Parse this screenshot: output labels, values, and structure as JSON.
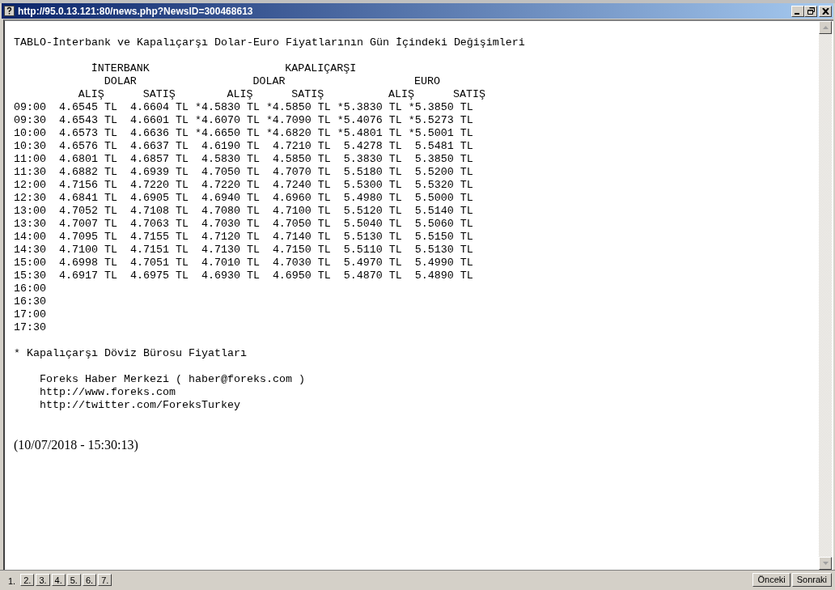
{
  "window": {
    "title": "http://95.0.13.121:80/news.php?NewsID=300468613"
  },
  "article": {
    "headline": "TABLO-İnterbank ve Kapalıçarşı Dolar-Euro Fiyatlarının Gün İçindeki Değişimleri",
    "group_headers": [
      "İNTERBANK",
      "KAPALIÇARŞI"
    ],
    "currency_headers": [
      "DOLAR",
      "DOLAR",
      "EURO"
    ],
    "column_headers": [
      "ALIŞ",
      "SATIŞ",
      "ALIŞ",
      "SATIŞ",
      "ALIŞ",
      "SATIŞ"
    ],
    "rows": [
      {
        "time": "09:00",
        "values": [
          "4.6545 TL",
          "4.6604 TL",
          "*4.5830 TL",
          "*4.5850 TL",
          "*5.3830 TL",
          "*5.3850 TL"
        ]
      },
      {
        "time": "09:30",
        "values": [
          "4.6543 TL",
          "4.6601 TL",
          "*4.6070 TL",
          "*4.7090 TL",
          "*5.4076 TL",
          "*5.5273 TL"
        ]
      },
      {
        "time": "10:00",
        "values": [
          "4.6573 TL",
          "4.6636 TL",
          "*4.6650 TL",
          "*4.6820 TL",
          "*5.4801 TL",
          "*5.5001 TL"
        ]
      },
      {
        "time": "10:30",
        "values": [
          "4.6576 TL",
          "4.6637 TL",
          "4.6190 TL",
          "4.7210 TL",
          "5.4278 TL",
          "5.5481 TL"
        ]
      },
      {
        "time": "11:00",
        "values": [
          "4.6801 TL",
          "4.6857 TL",
          "4.5830 TL",
          "4.5850 TL",
          "5.3830 TL",
          "5.3850 TL"
        ]
      },
      {
        "time": "11:30",
        "values": [
          "4.6882 TL",
          "4.6939 TL",
          "4.7050 TL",
          "4.7070 TL",
          "5.5180 TL",
          "5.5200 TL"
        ]
      },
      {
        "time": "12:00",
        "values": [
          "4.7156 TL",
          "4.7220 TL",
          "4.7220 TL",
          "4.7240 TL",
          "5.5300 TL",
          "5.5320 TL"
        ]
      },
      {
        "time": "12:30",
        "values": [
          "4.6841 TL",
          "4.6905 TL",
          "4.6940 TL",
          "4.6960 TL",
          "5.4980 TL",
          "5.5000 TL"
        ]
      },
      {
        "time": "13:00",
        "values": [
          "4.7052 TL",
          "4.7108 TL",
          "4.7080 TL",
          "4.7100 TL",
          "5.5120 TL",
          "5.5140 TL"
        ]
      },
      {
        "time": "13:30",
        "values": [
          "4.7007 TL",
          "4.7063 TL",
          "4.7030 TL",
          "4.7050 TL",
          "5.5040 TL",
          "5.5060 TL"
        ]
      },
      {
        "time": "14:00",
        "values": [
          "4.7095 TL",
          "4.7155 TL",
          "4.7120 TL",
          "4.7140 TL",
          "5.5130 TL",
          "5.5150 TL"
        ]
      },
      {
        "time": "14:30",
        "values": [
          "4.7100 TL",
          "4.7151 TL",
          "4.7130 TL",
          "4.7150 TL",
          "5.5110 TL",
          "5.5130 TL"
        ]
      },
      {
        "time": "15:00",
        "values": [
          "4.6998 TL",
          "4.7051 TL",
          "4.7010 TL",
          "4.7030 TL",
          "5.4970 TL",
          "5.4990 TL"
        ]
      },
      {
        "time": "15:30",
        "values": [
          "4.6917 TL",
          "4.6975 TL",
          "4.6930 TL",
          "4.6950 TL",
          "5.4870 TL",
          "5.4890 TL"
        ]
      },
      {
        "time": "16:00"
      },
      {
        "time": "16:30"
      },
      {
        "time": "17:00"
      },
      {
        "time": "17:30"
      }
    ],
    "footnote": "* Kapalıçarşı Döviz Bürosu Fiyatları",
    "source_lines": [
      "Foreks Haber Merkezi ( haber@foreks.com )",
      "http://www.foreks.com",
      "http://twitter.com/ForeksTurkey"
    ],
    "timestamp": "(10/07/2018 - 15:30:13)"
  },
  "pages": [
    {
      "label": "1.",
      "selected": true
    },
    {
      "label": "2.",
      "selected": false
    },
    {
      "label": "3.",
      "selected": false
    },
    {
      "label": "4.",
      "selected": false
    },
    {
      "label": "5.",
      "selected": false
    },
    {
      "label": "6.",
      "selected": false
    },
    {
      "label": "7.",
      "selected": false
    }
  ],
  "nav_buttons": [
    "Önceki",
    "Sonraki"
  ]
}
